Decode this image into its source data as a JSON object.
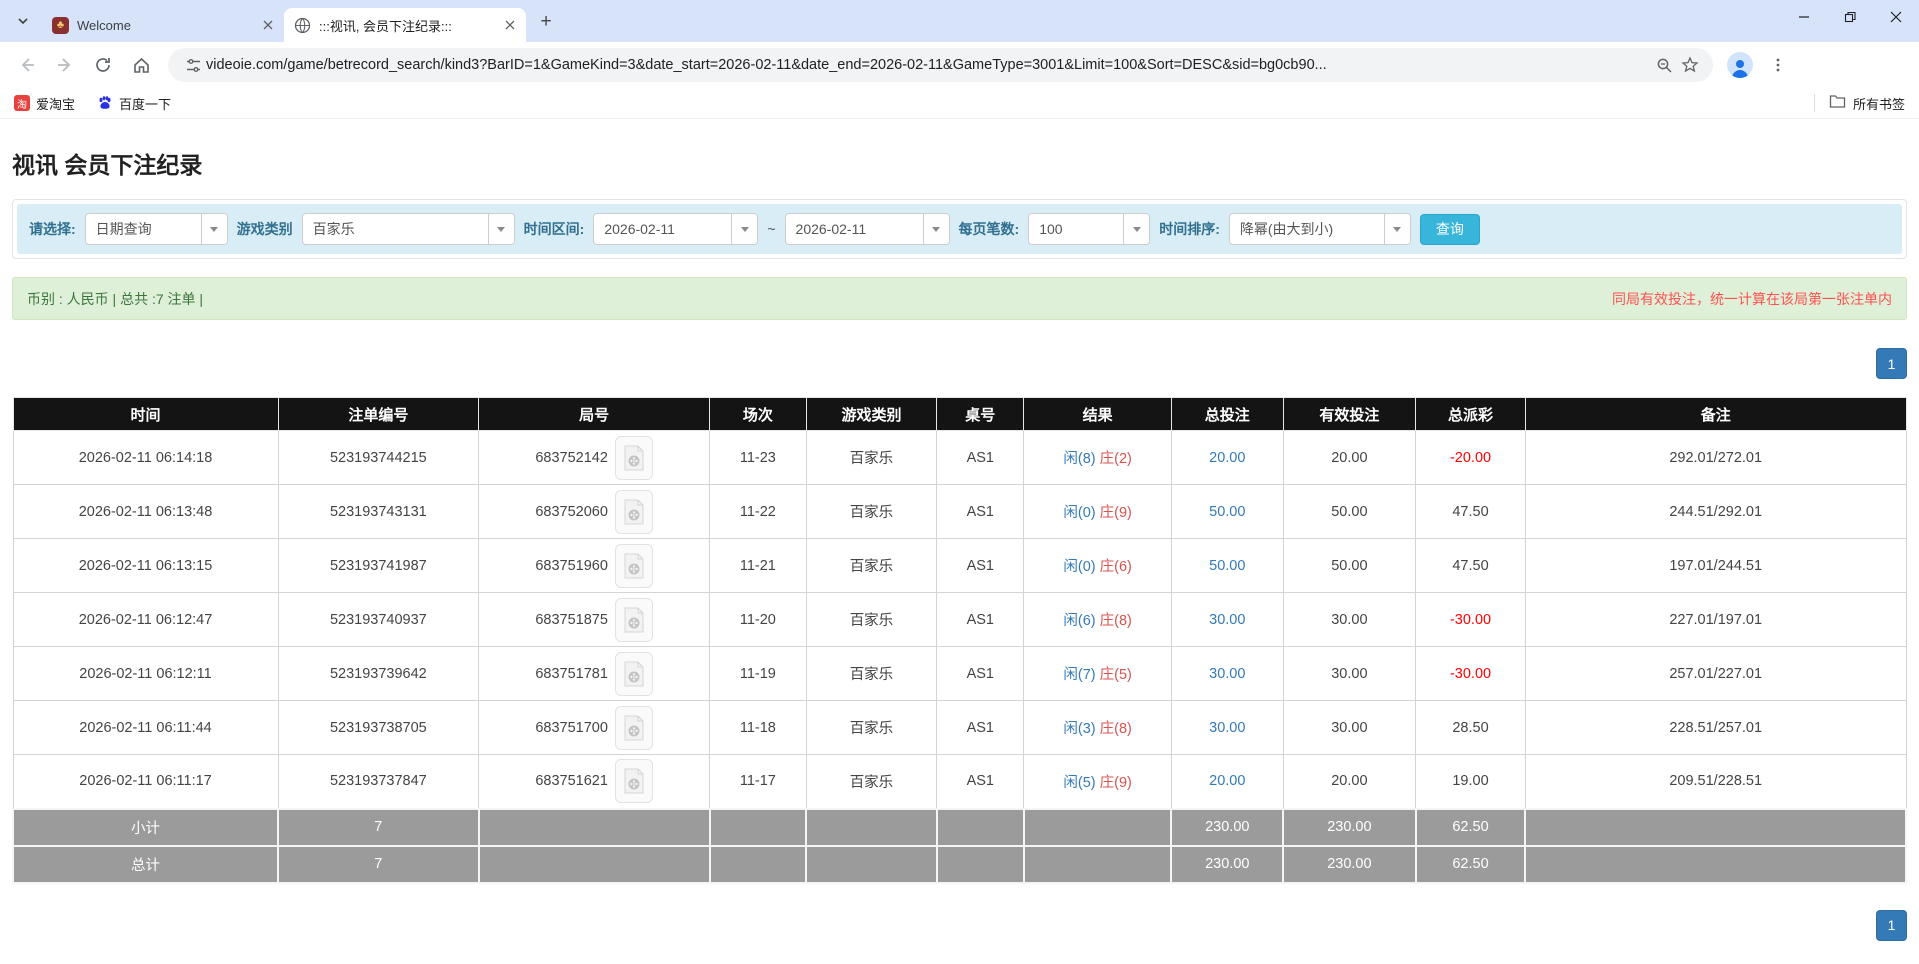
{
  "browser": {
    "tabs": [
      {
        "title": "Welcome"
      },
      {
        "title": ":::视讯, 会员下注纪录:::"
      }
    ],
    "new_tab_icon": "+",
    "url": "videoie.com/game/betrecord_search/kind3?BarID=1&GameKind=3&date_start=2026-02-11&date_end=2026-02-11&GameType=3001&Limit=100&Sort=DESC&sid=bg0cb90...",
    "bookmarks": [
      {
        "label": "爱淘宝",
        "icon_letter": "淘"
      },
      {
        "label": "百度一下"
      }
    ],
    "all_bookmarks_label": "所有书签"
  },
  "page": {
    "title": "视讯 会员下注纪录",
    "filters": {
      "select_label": "请选择:",
      "select_value": "日期查询",
      "game_kind_label": "游戏类别",
      "game_kind_value": "百家乐",
      "date_range_label": "时间区间:",
      "date_start": "2026-02-11",
      "date_separator": "~",
      "date_end": "2026-02-11",
      "per_page_label": "每页笔数:",
      "per_page_value": "100",
      "sort_label": "时间排序:",
      "sort_value": "降幂(由大到小)",
      "search_button": "查询"
    },
    "summary": {
      "left": "币别 : 人民币 | 总共 :7 注单 |",
      "right": "同局有效投注，统一计算在该局第一张注单内"
    },
    "pagination": {
      "page": "1"
    },
    "table": {
      "headers": [
        "时间",
        "注单编号",
        "局号",
        "场次",
        "游戏类别",
        "桌号",
        "结果",
        "总投注",
        "有效投注",
        "总派彩",
        "备注"
      ],
      "rows": [
        {
          "time": "2026-02-11 06:14:18",
          "bet_id": "523193744215",
          "round_id": "683752142",
          "session": "11-23",
          "game": "百家乐",
          "table_no": "AS1",
          "result_player": "闲(8)",
          "result_banker": "庄(2)",
          "total_bet": "20.00",
          "valid_bet": "20.00",
          "payout": "-20.00",
          "remark": "292.01/272.01"
        },
        {
          "time": "2026-02-11 06:13:48",
          "bet_id": "523193743131",
          "round_id": "683752060",
          "session": "11-22",
          "game": "百家乐",
          "table_no": "AS1",
          "result_player": "闲(0)",
          "result_banker": "庄(9)",
          "total_bet": "50.00",
          "valid_bet": "50.00",
          "payout": "47.50",
          "remark": "244.51/292.01"
        },
        {
          "time": "2026-02-11 06:13:15",
          "bet_id": "523193741987",
          "round_id": "683751960",
          "session": "11-21",
          "game": "百家乐",
          "table_no": "AS1",
          "result_player": "闲(0)",
          "result_banker": "庄(6)",
          "total_bet": "50.00",
          "valid_bet": "50.00",
          "payout": "47.50",
          "remark": "197.01/244.51"
        },
        {
          "time": "2026-02-11 06:12:47",
          "bet_id": "523193740937",
          "round_id": "683751875",
          "session": "11-20",
          "game": "百家乐",
          "table_no": "AS1",
          "result_player": "闲(6)",
          "result_banker": "庄(8)",
          "total_bet": "30.00",
          "valid_bet": "30.00",
          "payout": "-30.00",
          "remark": "227.01/197.01"
        },
        {
          "time": "2026-02-11 06:12:11",
          "bet_id": "523193739642",
          "round_id": "683751781",
          "session": "11-19",
          "game": "百家乐",
          "table_no": "AS1",
          "result_player": "闲(7)",
          "result_banker": "庄(5)",
          "total_bet": "30.00",
          "valid_bet": "30.00",
          "payout": "-30.00",
          "remark": "257.01/227.01"
        },
        {
          "time": "2026-02-11 06:11:44",
          "bet_id": "523193738705",
          "round_id": "683751700",
          "session": "11-18",
          "game": "百家乐",
          "table_no": "AS1",
          "result_player": "闲(3)",
          "result_banker": "庄(8)",
          "total_bet": "30.00",
          "valid_bet": "30.00",
          "payout": "28.50",
          "remark": "228.51/257.01"
        },
        {
          "time": "2026-02-11 06:11:17",
          "bet_id": "523193737847",
          "round_id": "683751621",
          "session": "11-17",
          "game": "百家乐",
          "table_no": "AS1",
          "result_player": "闲(5)",
          "result_banker": "庄(9)",
          "total_bet": "20.00",
          "valid_bet": "20.00",
          "payout": "19.00",
          "remark": "209.51/228.51"
        }
      ],
      "subtotal": {
        "label": "小计",
        "count": "7",
        "total_bet": "230.00",
        "valid_bet": "230.00",
        "payout": "62.50"
      },
      "total": {
        "label": "总计",
        "count": "7",
        "total_bet": "230.00",
        "valid_bet": "230.00",
        "payout": "62.50"
      }
    },
    "colors": {
      "accent_blue": "#337ab7",
      "banker_red": "#d9534f",
      "negative_red": "#ff0000",
      "search_button_cyan": "#38b5da",
      "summary_green_bg": "#dff0d8",
      "summary_text_green": "#3c763d",
      "notice_red": "#ff5151",
      "header_black": "#141414",
      "footer_gray": "#9b9b9b",
      "filter_bar_blue": "#d9edf7"
    }
  }
}
